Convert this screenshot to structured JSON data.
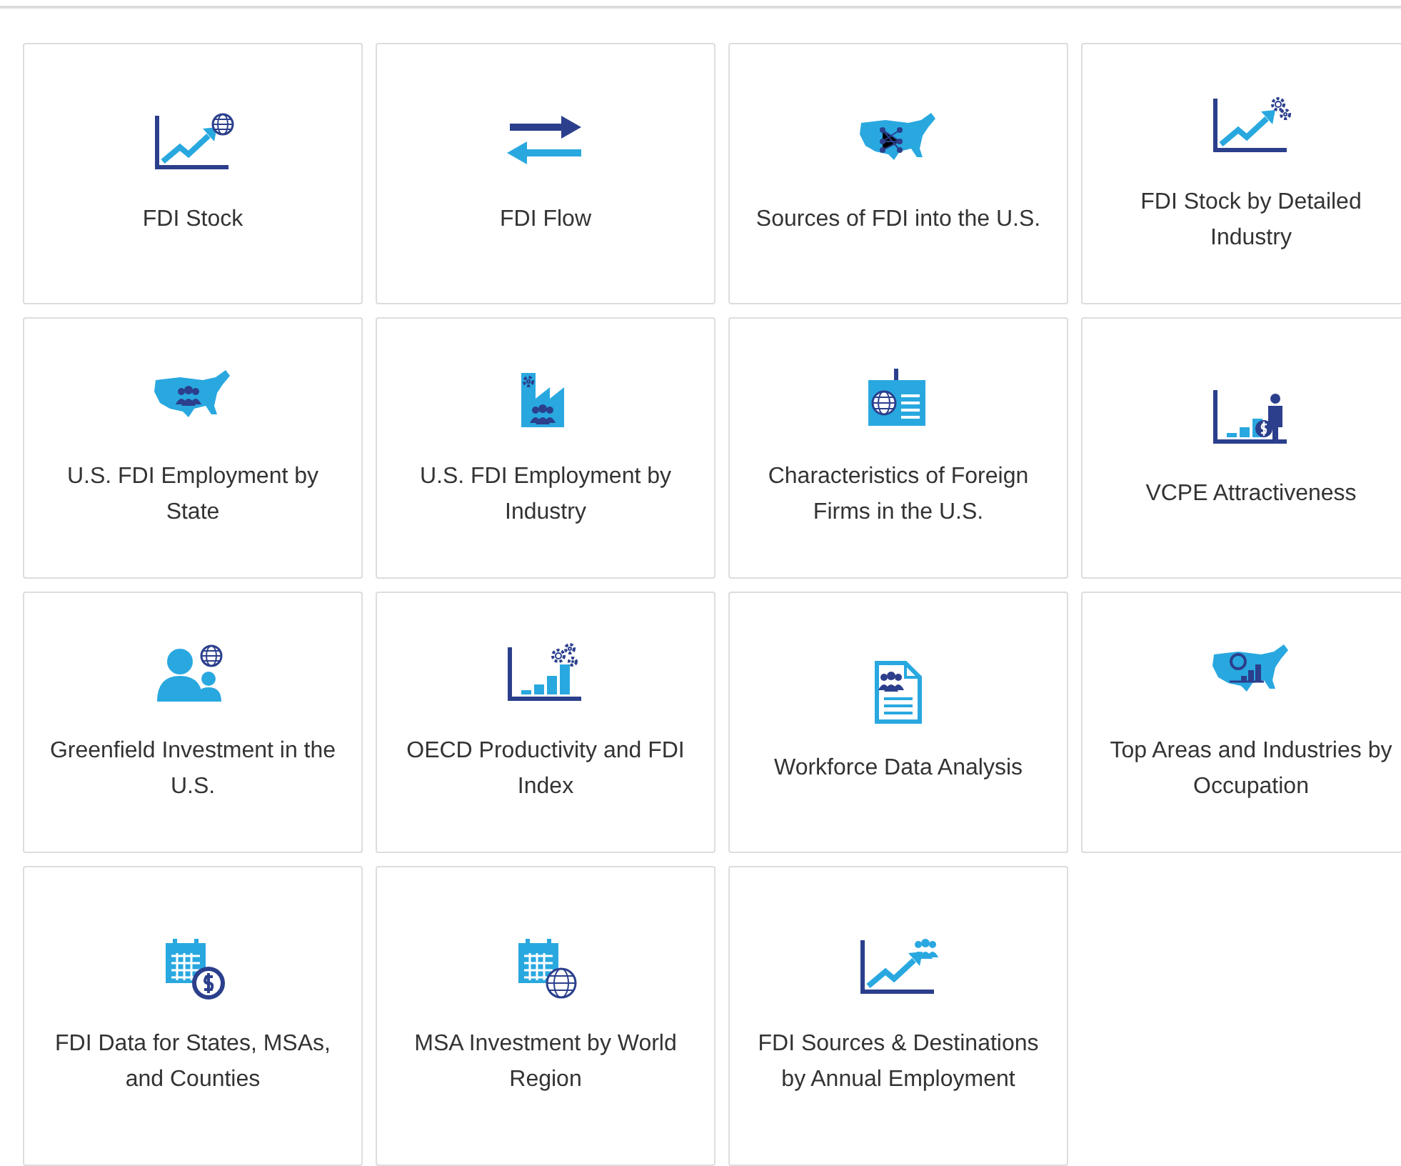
{
  "tiles": [
    {
      "kind": "chart-globe",
      "label": "FDI Stock"
    },
    {
      "kind": "arrows",
      "label": "FDI Flow"
    },
    {
      "kind": "map-network",
      "label": "Sources of FDI into the U.S."
    },
    {
      "kind": "chart-gears",
      "label": "FDI Stock by Detailed Industry"
    },
    {
      "kind": "map-people",
      "label": "U.S. FDI Employment by State"
    },
    {
      "kind": "factory-people",
      "label": "U.S. FDI Employment by Industry"
    },
    {
      "kind": "badge-globe",
      "label": "Characteristics of Foreign Firms in the U.S."
    },
    {
      "kind": "bars-person",
      "label": "VCPE Attractiveness"
    },
    {
      "kind": "people-globe",
      "label": "Greenfield Investment in the U.S."
    },
    {
      "kind": "bars-gears",
      "label": "OECD Productivity and FDI Index"
    },
    {
      "kind": "document-people",
      "label": "Workforce Data Analysis"
    },
    {
      "kind": "map-bars",
      "label": "Top Areas and Industries by Occupation"
    },
    {
      "kind": "calendar-dollar",
      "label": "FDI Data for States, MSAs, and Counties"
    },
    {
      "kind": "calendar-globe",
      "label": "MSA Investment by World Region"
    },
    {
      "kind": "chart-people",
      "label": "FDI Sources & Destinations by Annual Employment"
    }
  ]
}
